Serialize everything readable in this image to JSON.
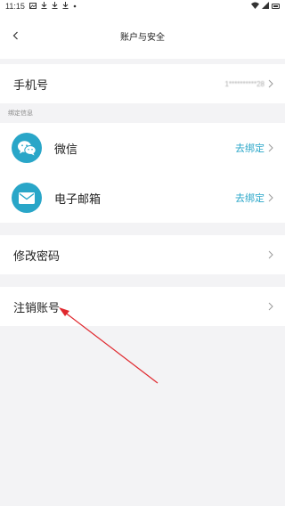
{
  "status_bar": {
    "time": "11:15",
    "icons": [
      "image-icon",
      "download-icon",
      "download-icon",
      "download-icon",
      "dot-icon"
    ],
    "right_icons": [
      "wifi-icon",
      "signal-icon",
      "battery-icon"
    ]
  },
  "nav": {
    "title": "账户与安全",
    "back_icon": "chevron-left-icon"
  },
  "phone": {
    "label": "手机号",
    "value": "1**********28"
  },
  "bind_section": {
    "header": "绑定信息",
    "items": [
      {
        "label": "微信",
        "action": "去绑定",
        "icon": "wechat-icon"
      },
      {
        "label": "电子邮箱",
        "action": "去绑定",
        "icon": "mail-icon"
      }
    ]
  },
  "change_password": {
    "label": "修改密码"
  },
  "cancel_account": {
    "label": "注销账号"
  },
  "colors": {
    "accent": "#29a6c8",
    "background": "#f3f3f5",
    "annotation": "#e0282e"
  }
}
